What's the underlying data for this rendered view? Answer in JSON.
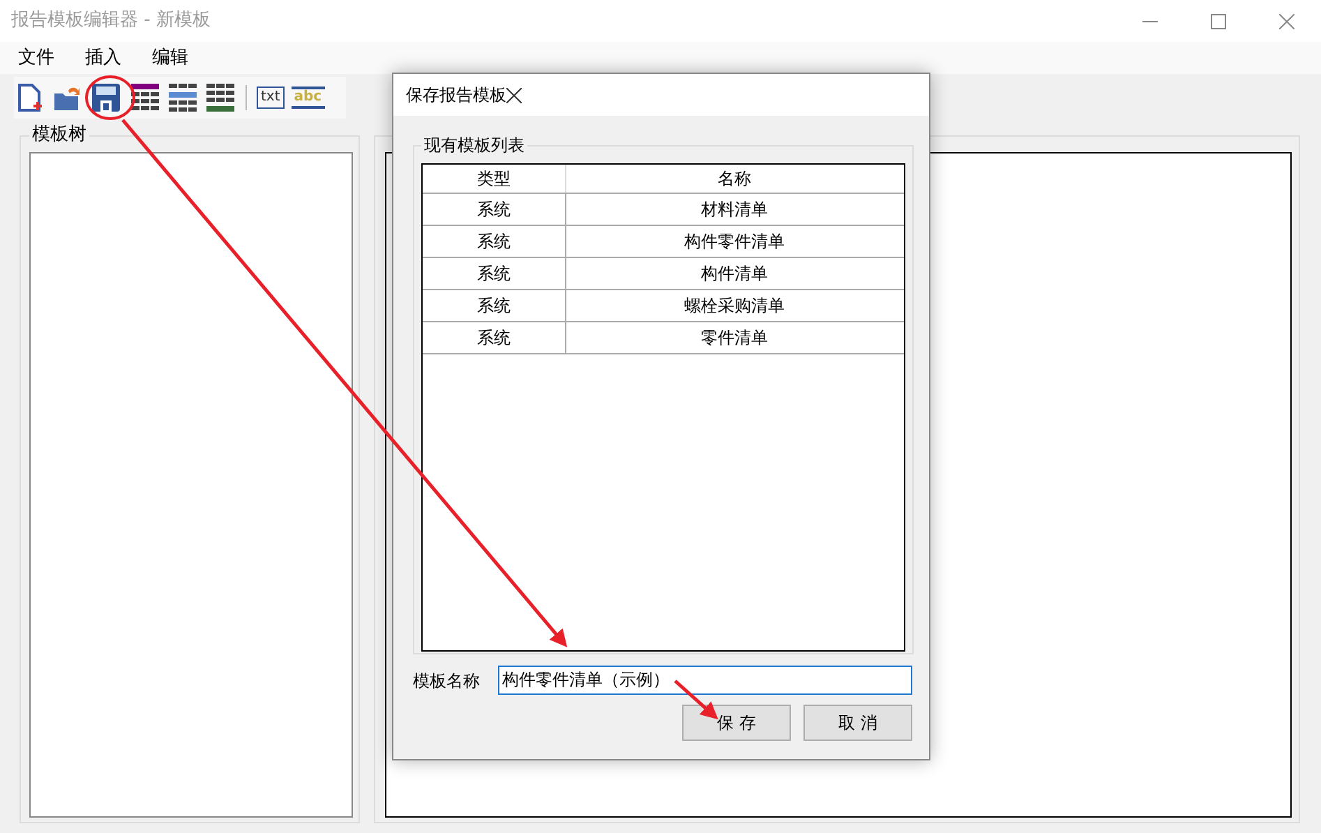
{
  "window": {
    "title": "报告模板编辑器 - 新模板"
  },
  "menu": [
    "文件",
    "插入",
    "编辑"
  ],
  "toolbar": [
    {
      "kind": "new"
    },
    {
      "kind": "open"
    },
    {
      "kind": "save"
    },
    {
      "kind": "table-purple"
    },
    {
      "kind": "table-blue"
    },
    {
      "kind": "table-green"
    },
    {
      "kind": "sep"
    },
    {
      "kind": "txt",
      "label": "txt"
    },
    {
      "kind": "abc",
      "label": "abc"
    }
  ],
  "left_panel": {
    "title": "模板树"
  },
  "dialog": {
    "title": "保存报告模板",
    "group_title": "现有模板列表",
    "table": {
      "columns": [
        "类型",
        "名称"
      ],
      "rows": [
        [
          "系统",
          "材料清单"
        ],
        [
          "系统",
          "构件零件清单"
        ],
        [
          "系统",
          "构件清单"
        ],
        [
          "系统",
          "螺栓采购清单"
        ],
        [
          "系统",
          "零件清单"
        ]
      ]
    },
    "name_label": "模板名称",
    "name_value": "构件零件清单（示例）",
    "buttons": [
      "保 存",
      "取 消"
    ]
  }
}
